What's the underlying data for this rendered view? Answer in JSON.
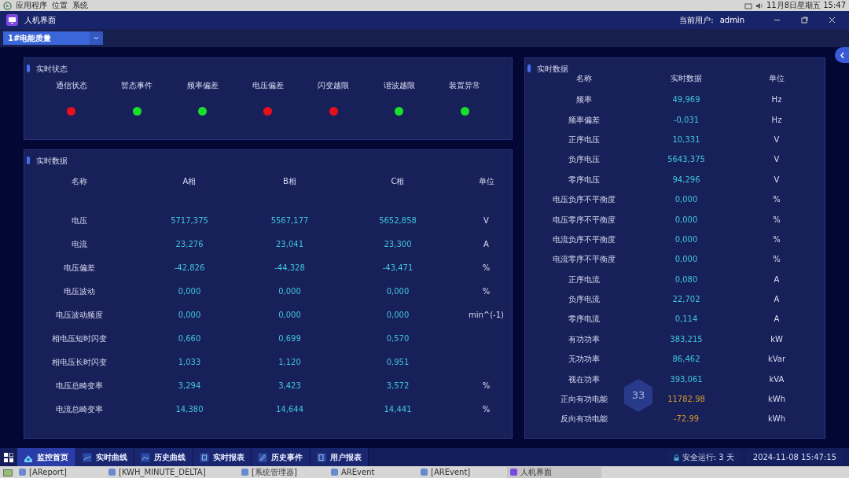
{
  "system_bar": {
    "menus": [
      "应用程序",
      "位置",
      "系统"
    ],
    "clock": "11月8日星期五 15:47"
  },
  "window": {
    "title": "人机界面",
    "user_label": "当前用户:",
    "user": "admin"
  },
  "device_select": {
    "value": "1#电能质量"
  },
  "status_panel": {
    "title": "实时状态",
    "items": [
      {
        "label": "通信状态",
        "color": "#e8101a"
      },
      {
        "label": "暂态事件",
        "color": "#18e02a"
      },
      {
        "label": "频率偏差",
        "color": "#18e02a"
      },
      {
        "label": "电压偏差",
        "color": "#e8101a"
      },
      {
        "label": "闪变越限",
        "color": "#e8101a"
      },
      {
        "label": "谐波越限",
        "color": "#18e02a"
      },
      {
        "label": "装置异常",
        "color": "#18e02a"
      }
    ]
  },
  "phase_panel": {
    "title": "实时数据",
    "columns": [
      "名称",
      "A相",
      "B相",
      "C相",
      "单位"
    ],
    "rows": [
      [
        "电压",
        "5717,375",
        "5567,177",
        "5652,858",
        "V"
      ],
      [
        "电流",
        "23,276",
        "23,041",
        "23,300",
        "A"
      ],
      [
        "电压偏差",
        "-42,826",
        "-44,328",
        "-43,471",
        "%"
      ],
      [
        "电压波动",
        "0,000",
        "0,000",
        "0,000",
        "%"
      ],
      [
        "电压波动频度",
        "0,000",
        "0,000",
        "0,000",
        "min^(-1)"
      ],
      [
        "相电压短时闪变",
        "0,660",
        "0,699",
        "0,570",
        ""
      ],
      [
        "相电压长时闪变",
        "1,033",
        "1,120",
        "0,951",
        ""
      ],
      [
        "电压总畸变率",
        "3,294",
        "3,423",
        "3,572",
        "%"
      ],
      [
        "电流总畸变率",
        "14,380",
        "14,644",
        "14,441",
        "%"
      ]
    ]
  },
  "summary_panel": {
    "title": "实时数据",
    "columns": [
      "名称",
      "实时数据",
      "单位"
    ],
    "rows": [
      {
        "name": "频率",
        "value": "49,969",
        "unit": "Hz",
        "kind": "measure"
      },
      {
        "name": "频率偏差",
        "value": "-0,031",
        "unit": "Hz",
        "kind": "measure"
      },
      {
        "name": "正序电压",
        "value": "10,331",
        "unit": "V",
        "kind": "measure"
      },
      {
        "name": "负序电压",
        "value": "5643,375",
        "unit": "V",
        "kind": "measure"
      },
      {
        "name": "零序电压",
        "value": "94,296",
        "unit": "V",
        "kind": "measure"
      },
      {
        "name": "电压负序不平衡度",
        "value": "0,000",
        "unit": "%",
        "kind": "measure"
      },
      {
        "name": "电压零序不平衡度",
        "value": "0,000",
        "unit": "%",
        "kind": "measure"
      },
      {
        "name": "电流负序不平衡度",
        "value": "0,000",
        "unit": "%",
        "kind": "measure"
      },
      {
        "name": "电流零序不平衡度",
        "value": "0,000",
        "unit": "%",
        "kind": "measure"
      },
      {
        "name": "正序电流",
        "value": "0,080",
        "unit": "A",
        "kind": "measure"
      },
      {
        "name": "负序电流",
        "value": "22,702",
        "unit": "A",
        "kind": "measure"
      },
      {
        "name": "零序电流",
        "value": "0,114",
        "unit": "A",
        "kind": "measure"
      },
      {
        "name": "有功功率",
        "value": "383,215",
        "unit": "kW",
        "kind": "measure"
      },
      {
        "name": "无功功率",
        "value": "86,462",
        "unit": "kVar",
        "kind": "measure"
      },
      {
        "name": "视在功率",
        "value": "393,061",
        "unit": "kVA",
        "kind": "measure"
      },
      {
        "name": "正向有功电能",
        "value": "11782.98",
        "unit": "kWh",
        "kind": "energy"
      },
      {
        "name": "反向有功电能",
        "value": "-72.99",
        "unit": "kWh",
        "kind": "energy"
      }
    ]
  },
  "floating_badge": {
    "value": "33"
  },
  "nav_tabs": [
    {
      "label": "监控首页",
      "selected": true
    },
    {
      "label": "实时曲线",
      "selected": false
    },
    {
      "label": "历史曲线",
      "selected": false
    },
    {
      "label": "实时报表",
      "selected": false
    },
    {
      "label": "历史事件",
      "selected": false
    },
    {
      "label": "用户报表",
      "selected": false
    }
  ],
  "status_bar": {
    "uptime": "安全运行: 3 天",
    "datetime": "2024-11-08 15:47:15"
  },
  "taskbar": [
    {
      "label": "[AReport]",
      "selected": false
    },
    {
      "label": "[KWH_MINUTE_DELTA]",
      "selected": false
    },
    {
      "label": "[系统管理器]",
      "selected": false
    },
    {
      "label": "AREvent",
      "selected": false
    },
    {
      "label": "[AREvent]",
      "selected": false
    },
    {
      "label": "人机界面",
      "selected": true
    }
  ]
}
